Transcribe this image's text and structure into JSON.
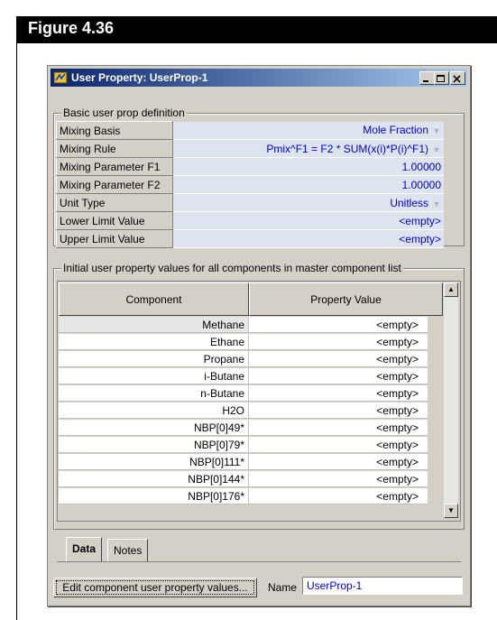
{
  "figure": {
    "title": "Figure 4.36"
  },
  "window": {
    "title": "User Property: UserProp-1"
  },
  "basic": {
    "legend": "Basic user prop definition",
    "rows": [
      {
        "label": "Mixing Basis",
        "value": "Mole Fraction"
      },
      {
        "label": "Mixing Rule",
        "value": "Pmix^F1 = F2 * SUM(x(i)*P(i)^F1)"
      },
      {
        "label": "Mixing Parameter F1",
        "value": "1.00000"
      },
      {
        "label": "Mixing Parameter F2",
        "value": "1.00000"
      },
      {
        "label": "Unit Type",
        "value": "Unitless"
      },
      {
        "label": "Lower Limit Value",
        "value": "<empty>"
      },
      {
        "label": "Upper Limit Value",
        "value": "<empty>"
      }
    ]
  },
  "components": {
    "legend": "Initial user property values for all components in master component list",
    "col_component": "Component",
    "col_value": "Property Value",
    "rows": [
      {
        "name": "Methane",
        "value": "<empty>"
      },
      {
        "name": "Ethane",
        "value": "<empty>"
      },
      {
        "name": "Propane",
        "value": "<empty>"
      },
      {
        "name": "i-Butane",
        "value": "<empty>"
      },
      {
        "name": "n-Butane",
        "value": "<empty>"
      },
      {
        "name": "H2O",
        "value": "<empty>"
      },
      {
        "name": "NBP[0]49*",
        "value": "<empty>"
      },
      {
        "name": "NBP[0]79*",
        "value": "<empty>"
      },
      {
        "name": "NBP[0]111*",
        "value": "<empty>"
      },
      {
        "name": "NBP[0]144*",
        "value": "<empty>"
      },
      {
        "name": "NBP[0]176*",
        "value": "<empty>"
      }
    ]
  },
  "tabs": {
    "data": "Data",
    "notes": "Notes"
  },
  "footer": {
    "edit_button": "Edit component user property values...",
    "name_label": "Name",
    "name_value": "UserProp-1"
  }
}
